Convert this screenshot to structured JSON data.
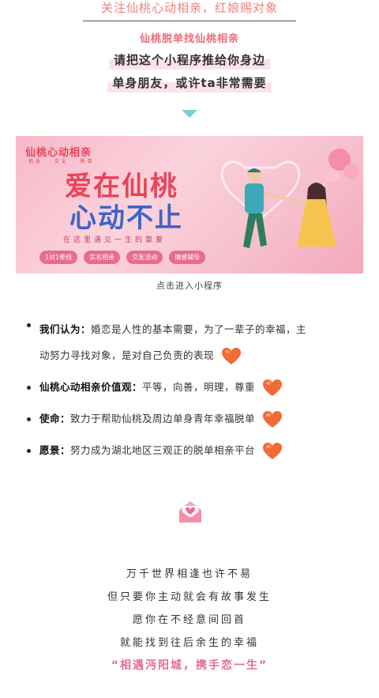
{
  "header": {
    "title": "关注仙桃心动相亲，红娘赐对象",
    "subtitle": "仙桃脱单找仙桃相亲",
    "line1": "请把这个小程序推给你身边",
    "line2": "单身朋友，或许ta非常需要"
  },
  "banner": {
    "logo": "仙桃心动相亲",
    "logo_sub": "相亲 · 交友 · 脱单",
    "headline1": "爱在仙桃",
    "headline2": "心动不止",
    "slogan": "在这里遇见一生的挚爱",
    "tags": [
      "1对1牵线",
      "实名相亲",
      "交友活动",
      "情感辅导"
    ]
  },
  "caption": "点击进入小程序",
  "values": [
    {
      "label": "我们认为：",
      "line1": "婚恋是人性的基本需要，为了一辈子的幸福，主",
      "line2": "动努力寻找对象，是对自己负责的表现"
    },
    {
      "label": "仙桃心动相亲价值观：",
      "text": "平等，向善，明理，尊重"
    },
    {
      "label": "使命：",
      "text": "致力于帮助仙桃及周边单身青年幸福脱单"
    },
    {
      "label": "愿景：",
      "text": "努力成为湖北地区三观正的脱单相亲平台"
    }
  ],
  "poem": [
    "万千世界相逢也许不易",
    "但只要你主动就会有故事发生",
    "愿你在不经意间回首",
    "就能找到往后余生的幸福"
  ],
  "closing": "“相遇沔阳城，携手恋一生”",
  "colors": {
    "accent_pink": "#e86a98",
    "title_pink": "#f08080",
    "arrow_teal": "#7fd0d3",
    "heart_orange": "#f26a35"
  },
  "icons": {
    "heart": "heart-icon",
    "envelope": "envelope-icon",
    "arrow": "arrow-down-icon"
  }
}
